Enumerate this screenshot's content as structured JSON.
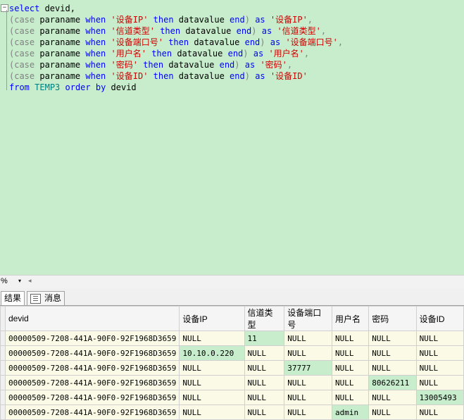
{
  "editor": {
    "lines": [
      [
        [
          "kw",
          "select"
        ],
        [
          "tx",
          " devid,"
        ]
      ],
      [
        [
          "gy",
          "(case"
        ],
        [
          "tx",
          " paraname "
        ],
        [
          "kw",
          "when"
        ],
        [
          "tx",
          " "
        ],
        [
          "st",
          "'设备IP'"
        ],
        [
          "tx",
          " "
        ],
        [
          "kw",
          "then"
        ],
        [
          "tx",
          " datavalue "
        ],
        [
          "kw",
          "end"
        ],
        [
          "gy",
          ")"
        ],
        [
          "tx",
          " "
        ],
        [
          "kw",
          "as"
        ],
        [
          "tx",
          " "
        ],
        [
          "st",
          "'设备IP'"
        ],
        [
          "gy",
          ","
        ]
      ],
      [
        [
          "gy",
          "(case"
        ],
        [
          "tx",
          " paraname "
        ],
        [
          "kw",
          "when"
        ],
        [
          "tx",
          " "
        ],
        [
          "st",
          "'信道类型'"
        ],
        [
          "tx",
          " "
        ],
        [
          "kw",
          "then"
        ],
        [
          "tx",
          " datavalue "
        ],
        [
          "kw",
          "end"
        ],
        [
          "gy",
          ")"
        ],
        [
          "tx",
          " "
        ],
        [
          "kw",
          "as"
        ],
        [
          "tx",
          " "
        ],
        [
          "st",
          "'信道类型'"
        ],
        [
          "gy",
          ","
        ]
      ],
      [
        [
          "gy",
          "(case"
        ],
        [
          "tx",
          " paraname "
        ],
        [
          "kw",
          "when"
        ],
        [
          "tx",
          " "
        ],
        [
          "st",
          "'设备端口号'"
        ],
        [
          "tx",
          " "
        ],
        [
          "kw",
          "then"
        ],
        [
          "tx",
          " datavalue "
        ],
        [
          "kw",
          "end"
        ],
        [
          "gy",
          ")"
        ],
        [
          "tx",
          " "
        ],
        [
          "kw",
          "as"
        ],
        [
          "tx",
          " "
        ],
        [
          "st",
          "'设备端口号'"
        ],
        [
          "gy",
          ","
        ]
      ],
      [
        [
          "gy",
          "(case"
        ],
        [
          "tx",
          " paraname "
        ],
        [
          "kw",
          "when"
        ],
        [
          "tx",
          " "
        ],
        [
          "st",
          "'用户名'"
        ],
        [
          "tx",
          " "
        ],
        [
          "kw",
          "then"
        ],
        [
          "tx",
          " datavalue "
        ],
        [
          "kw",
          "end"
        ],
        [
          "gy",
          ")"
        ],
        [
          "tx",
          " "
        ],
        [
          "kw",
          "as"
        ],
        [
          "tx",
          " "
        ],
        [
          "st",
          "'用户名'"
        ],
        [
          "gy",
          ","
        ]
      ],
      [
        [
          "gy",
          "(case"
        ],
        [
          "tx",
          " paraname "
        ],
        [
          "kw",
          "when"
        ],
        [
          "tx",
          " "
        ],
        [
          "st",
          "'密码'"
        ],
        [
          "tx",
          " "
        ],
        [
          "kw",
          "then"
        ],
        [
          "tx",
          " datavalue "
        ],
        [
          "kw",
          "end"
        ],
        [
          "gy",
          ")"
        ],
        [
          "tx",
          " "
        ],
        [
          "kw",
          "as"
        ],
        [
          "tx",
          " "
        ],
        [
          "st",
          "'密码'"
        ],
        [
          "gy",
          ","
        ]
      ],
      [
        [
          "gy",
          "(case"
        ],
        [
          "tx",
          " paraname "
        ],
        [
          "kw",
          "when"
        ],
        [
          "tx",
          " "
        ],
        [
          "st",
          "'设备ID'"
        ],
        [
          "tx",
          " "
        ],
        [
          "kw",
          "then"
        ],
        [
          "tx",
          " datavalue "
        ],
        [
          "kw",
          "end"
        ],
        [
          "gy",
          ")"
        ],
        [
          "tx",
          " "
        ],
        [
          "kw",
          "as"
        ],
        [
          "tx",
          " "
        ],
        [
          "st",
          "'设备ID'"
        ]
      ],
      [
        [
          "kw",
          "from"
        ],
        [
          "tx",
          " "
        ],
        [
          "id",
          "TEMP3"
        ],
        [
          "tx",
          " "
        ],
        [
          "kw",
          "order by"
        ],
        [
          "tx",
          " devid"
        ]
      ]
    ]
  },
  "status": {
    "zoom": "%",
    "zoom_arrow": "▾",
    "scroll_left": "◂"
  },
  "tabs": [
    {
      "label": "结果"
    },
    {
      "label": "消息"
    }
  ],
  "grid": {
    "columns": [
      "devid",
      "设备IP",
      "信道类型",
      "设备端口号",
      "用户名",
      "密码",
      "设备ID"
    ],
    "widths": [
      230,
      90,
      62,
      76,
      50,
      62,
      62
    ],
    "rows": [
      [
        "00000509-7208-441A-90F0-92F1968D3659",
        "NULL",
        "11",
        "NULL",
        "NULL",
        "NULL",
        "NULL"
      ],
      [
        "00000509-7208-441A-90F0-92F1968D3659",
        "10.10.0.220",
        "NULL",
        "NULL",
        "NULL",
        "NULL",
        "NULL"
      ],
      [
        "00000509-7208-441A-90F0-92F1968D3659",
        "NULL",
        "NULL",
        "37777",
        "NULL",
        "NULL",
        "NULL"
      ],
      [
        "00000509-7208-441A-90F0-92F1968D3659",
        "NULL",
        "NULL",
        "NULL",
        "NULL",
        "80626211",
        "NULL"
      ],
      [
        "00000509-7208-441A-90F0-92F1968D3659",
        "NULL",
        "NULL",
        "NULL",
        "NULL",
        "NULL",
        "13005493"
      ],
      [
        "00000509-7208-441A-90F0-92F1968D3659",
        "NULL",
        "NULL",
        "NULL",
        "admin",
        "NULL",
        "NULL"
      ]
    ],
    "highlights": [
      [
        0,
        2
      ],
      [
        1,
        1
      ],
      [
        2,
        3
      ],
      [
        3,
        5
      ],
      [
        4,
        6
      ],
      [
        5,
        4
      ]
    ]
  }
}
